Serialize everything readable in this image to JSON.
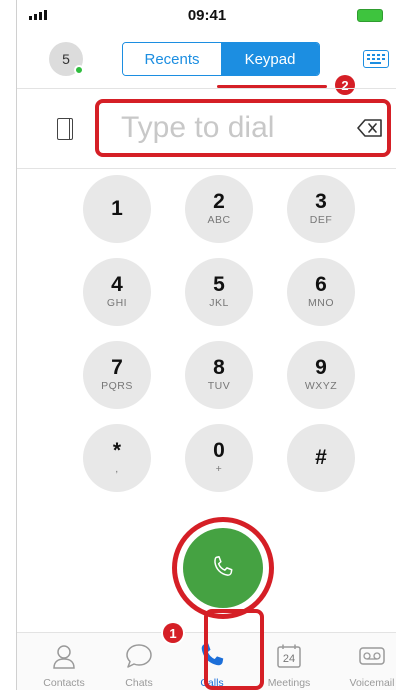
{
  "status_bar": {
    "time": "09:41"
  },
  "header": {
    "avatar_label": "5",
    "tabs": [
      {
        "label": "Recents",
        "active": false
      },
      {
        "label": "Keypad",
        "active": true
      }
    ]
  },
  "dial": {
    "placeholder": "Type to dial"
  },
  "keypad": [
    {
      "digit": "1",
      "letters": ""
    },
    {
      "digit": "2",
      "letters": "ABC"
    },
    {
      "digit": "3",
      "letters": "DEF"
    },
    {
      "digit": "4",
      "letters": "GHI"
    },
    {
      "digit": "5",
      "letters": "JKL"
    },
    {
      "digit": "6",
      "letters": "MNO"
    },
    {
      "digit": "7",
      "letters": "PQRS"
    },
    {
      "digit": "8",
      "letters": "TUV"
    },
    {
      "digit": "9",
      "letters": "WXYZ"
    },
    {
      "digit": "*",
      "letters": ","
    },
    {
      "digit": "0",
      "letters": "+"
    },
    {
      "digit": "#",
      "letters": ""
    }
  ],
  "annotations": {
    "badge_1": "1",
    "badge_2": "2"
  },
  "tabbar": {
    "items": [
      {
        "label": "Contacts",
        "icon": "contacts-icon"
      },
      {
        "label": "Chats",
        "icon": "chat-bubble-icon"
      },
      {
        "label": "Calls",
        "icon": "phone-icon",
        "active": true
      },
      {
        "label": "Meetings",
        "icon": "calendar-icon",
        "calendar_day": "24"
      },
      {
        "label": "Voicemail",
        "icon": "voicemail-icon"
      }
    ]
  },
  "colors": {
    "accent": "#1c8ee1",
    "call_green": "#45a242",
    "annotation_red": "#d51f26",
    "presence_green": "#2fbd3e"
  }
}
